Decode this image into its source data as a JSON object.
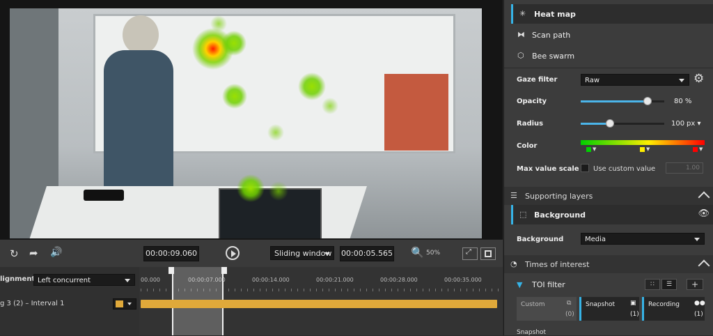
{
  "player": {
    "current_time": "00:00:09.060",
    "window_mode": "Sliding window",
    "window_length": "00:00:05.565",
    "zoom": "50%"
  },
  "timeline": {
    "alignment_label": "Alignment",
    "alignment_value": "Left concurrent",
    "track_label": "g 3 (2) – Interval 1",
    "ticks": [
      "00.000",
      "00:00:07.000",
      "00:00:14.000",
      "00:00:21.000",
      "00:00:28.000",
      "00:00:35.000"
    ],
    "track_color": "#e0a93a"
  },
  "viz_types": [
    {
      "label": "Heat map",
      "icon": "heatmap-icon",
      "active": true
    },
    {
      "label": "Scan path",
      "icon": "scanpath-icon",
      "active": false
    },
    {
      "label": "Bee swarm",
      "icon": "beeswarm-icon",
      "active": false
    }
  ],
  "settings": {
    "gaze_filter_label": "Gaze filter",
    "gaze_filter_value": "Raw",
    "opacity_label": "Opacity",
    "opacity_value": "80 %",
    "opacity_level": 0.8,
    "radius_label": "Radius",
    "radius_value": "100",
    "radius_unit": "px",
    "color_label": "Color",
    "max_value_label": "Max value scale",
    "custom_value_label": "Use custom value",
    "custom_value": "1.00"
  },
  "supporting_layers": {
    "title": "Supporting layers",
    "layer": "Background",
    "bg_label": "Background",
    "bg_value": "Media"
  },
  "toi": {
    "title": "Times of interest",
    "filter_label": "TOI filter",
    "cards": [
      {
        "label": "Custom",
        "count": "(0)"
      },
      {
        "label": "Snapshot",
        "count": "(1)"
      },
      {
        "label": "Recording",
        "count": "(1)"
      }
    ],
    "footer": "Snapshot"
  },
  "colors": {
    "accent": "#36b3e6",
    "panel": "#3c3c3c",
    "track": "#e0a93a"
  }
}
